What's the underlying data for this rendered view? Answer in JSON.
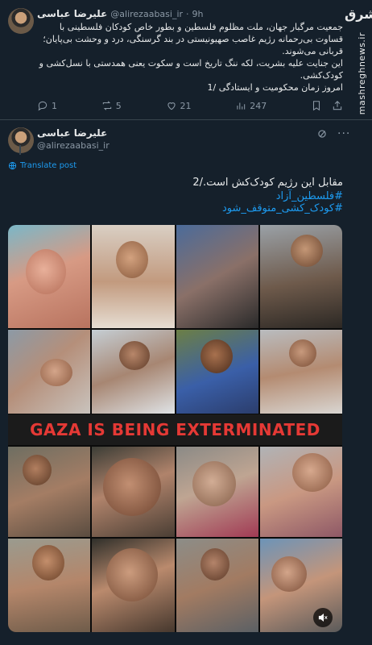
{
  "tweet1": {
    "author_name": "علیرضا عباسی",
    "handle": "@alirezaabasi_ir",
    "time": "9h",
    "lines": [
      "جمعیت مرگبار جهان، ملت مظلوم فلسطین و بطور خاص کودکان فلسطینی با",
      "قساوت بی‌رحمانه رژیم غاصب صهیونیستی در بند گرسنگی، درد و وحشت بی‌پایان؛",
      "قربانی می‌شوند.",
      "این جنایت علیه بشریت، لکه ننگ تاریخ است و سکوت یعنی همدستی با نسل‌کشی و",
      "کودک‌کشی.",
      "امروز زمان محکومیت و ایستادگی /1"
    ],
    "replies": "1",
    "reposts": "5",
    "likes": "21",
    "views": "247"
  },
  "tweet2": {
    "author_name": "علیرضا عباسی",
    "handle": "@alirezaabasi_ir",
    "translate": "Translate post",
    "text": "مقابل این رژیم کودک‌کش است./2",
    "hashtag1": "#فلسطین_آزاد",
    "hashtag2": "#کودک_کشی_متوقف_شود",
    "banner": "GAZA IS BEING EXTERMINATED"
  },
  "watermark": {
    "logo": "مشرق",
    "site": "mashreghnews.ir"
  },
  "colors": {
    "background": "#15202b",
    "accent": "#1d9bf0",
    "muted": "#8b98a5",
    "banner_text": "#e53935"
  }
}
